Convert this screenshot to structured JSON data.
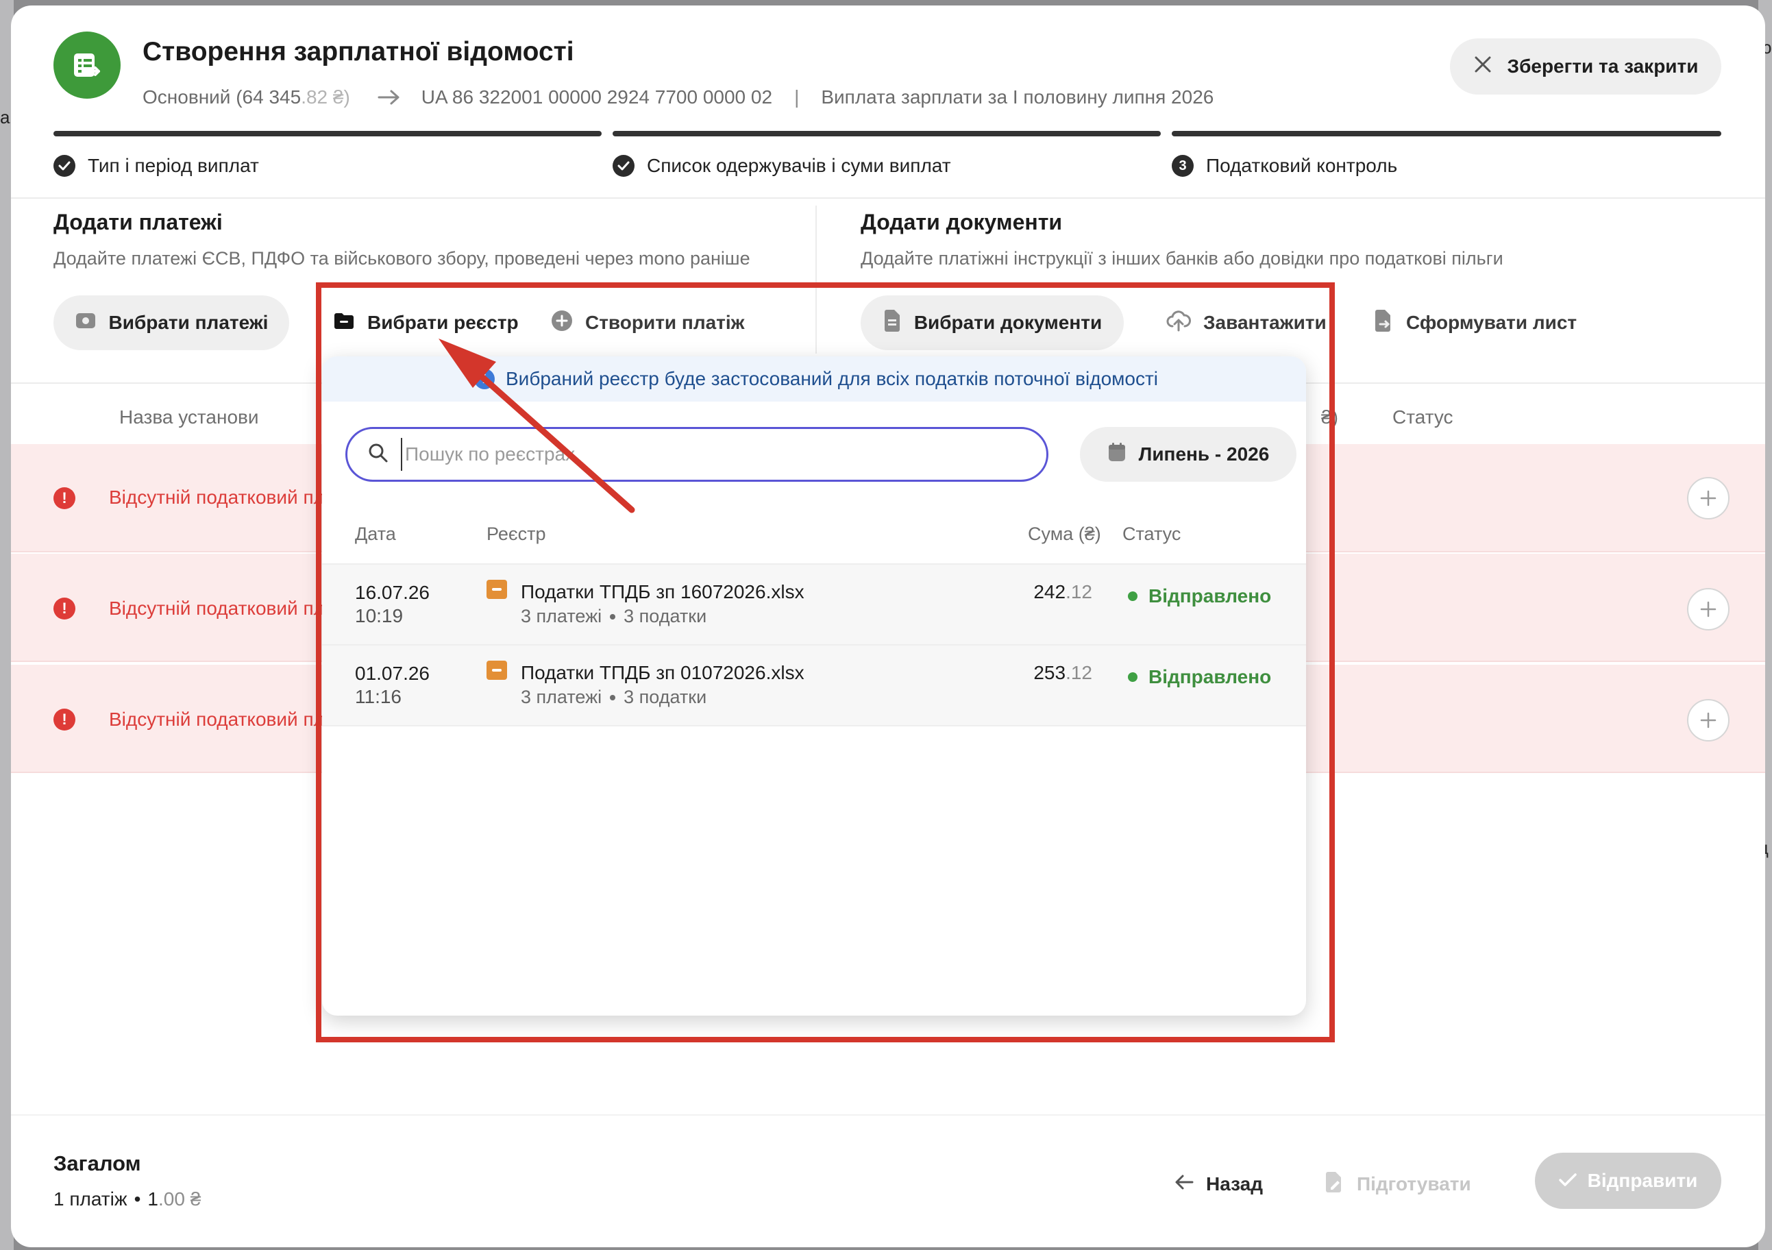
{
  "background": {
    "left_glyph": "а",
    "right_glyphs": [
      "ю",
      "ц"
    ]
  },
  "header": {
    "title": "Створення зарплатної відомості",
    "account_name": "Основний (64 345",
    "account_decimals": ".82 ₴)",
    "iban": "UA 86 322001 00000 2924 7700 0000 02",
    "separator": "|",
    "purpose": "Виплата зарплати за І половину липня 2026",
    "save_close_label": "Зберегти та закрити"
  },
  "steps": [
    {
      "label": "Тип і період виплат",
      "state": "done"
    },
    {
      "label": "Список одержувачів і суми виплат",
      "state": "done"
    },
    {
      "label": "Податковий контроль",
      "state": "current",
      "number": "3"
    }
  ],
  "add_payments": {
    "title": "Додати платежі",
    "subtitle": "Додайте платежі ЄСВ, ПДФО та військового збору, проведені через mono раніше",
    "select_payments_label": "Вибрати платежі",
    "select_registry_label": "Вибрати реєстр",
    "create_payment_label": "Створити платіж"
  },
  "add_documents": {
    "title": "Додати документи",
    "subtitle": "Додайте платіжні інструкції з інших банків або довідки про податкові пільги",
    "select_documents_label": "Вибрати документи",
    "upload_label": "Завантажити",
    "form_letter_label": "Сформувати лист"
  },
  "table": {
    "col_institution": "Назва установи",
    "col_sum_tail": "₴)",
    "col_status": "Статус",
    "rows": [
      {
        "error_text": "Відсутній податковий пла"
      },
      {
        "error_text": "Відсутній податковий пла"
      },
      {
        "error_text": "Відсутній податковий пла"
      }
    ]
  },
  "registry_dropdown": {
    "info_text": "Вибраний реєстр буде застосований для всіх податків поточної відомості",
    "search_placeholder": "Пошук по реєстрах",
    "search_value": "",
    "month_label": "Липень - 2026",
    "columns": {
      "date": "Дата",
      "registry": "Реєстр",
      "sum": "Сума (₴)",
      "status": "Статус"
    },
    "rows": [
      {
        "date": "16.07.26",
        "time": "10:19",
        "name": "Податки ТПДБ зп 16072026.xlsx",
        "payments": "3 платежі",
        "taxes": "3 податки",
        "sum_int": "242",
        "sum_dec": ".12",
        "status": "Відправлено"
      },
      {
        "date": "01.07.26",
        "time": "11:16",
        "name": "Податки ТПДБ зп 01072026.xlsx",
        "payments": "3 платежі",
        "taxes": "3 податки",
        "sum_int": "253",
        "sum_dec": ".12",
        "status": "Відправлено"
      }
    ]
  },
  "footer": {
    "total_title": "Загалом",
    "total_count": "1 платіж",
    "total_bullet": "•",
    "total_int": "1",
    "total_dec": ".00 ₴",
    "back_label": "Назад",
    "prepare_label": "Підготувати",
    "send_label": "Відправити"
  },
  "colors": {
    "accent_green": "#3e9a3a",
    "error_red": "#dc3d3a",
    "search_focus": "#5a55d6",
    "annotation_red": "#d3362b",
    "folder_orange": "#e38f36"
  }
}
